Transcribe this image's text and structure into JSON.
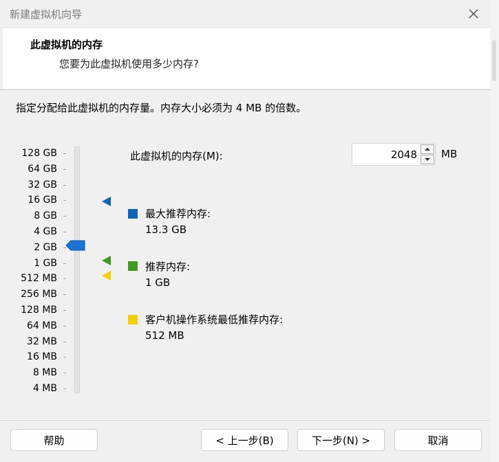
{
  "window": {
    "title": "新建虚拟机向导"
  },
  "header": {
    "title": "此虚拟机的内存",
    "subtitle": "您要为此虚拟机使用多少内存?"
  },
  "instruction": "指定分配给此虚拟机的内存量。内存大小必须为 4 MB 的倍数。",
  "scale": {
    "labels": [
      "128 GB",
      "64 GB",
      "32 GB",
      "16 GB",
      "8 GB",
      "4 GB",
      "2 GB",
      "1 GB",
      "512 MB",
      "256 MB",
      "128 MB",
      "64 MB",
      "32 MB",
      "16 MB",
      "8 MB",
      "4 MB"
    ],
    "selected": "2 GB"
  },
  "memory": {
    "label": "此虚拟机的内存(M):",
    "value": "2048",
    "unit": "MB"
  },
  "legend": [
    {
      "label": "最大推荐内存:",
      "value": "13.3 GB",
      "color": "#0d64b7"
    },
    {
      "label": "推荐内存:",
      "value": "1 GB",
      "color": "#3f9a1f"
    },
    {
      "label": "客户机操作系统最低推荐内存:",
      "value": "512 MB",
      "color": "#f2cf00"
    }
  ],
  "buttons": {
    "help": "帮助",
    "back": "< 上一步(B)",
    "next": "下一步(N) >",
    "cancel": "取消"
  },
  "icons": {
    "close": "close-icon",
    "spin_up": "chevron-up-icon",
    "spin_down": "chevron-down-icon",
    "thumb": "slider-thumb-icon"
  }
}
